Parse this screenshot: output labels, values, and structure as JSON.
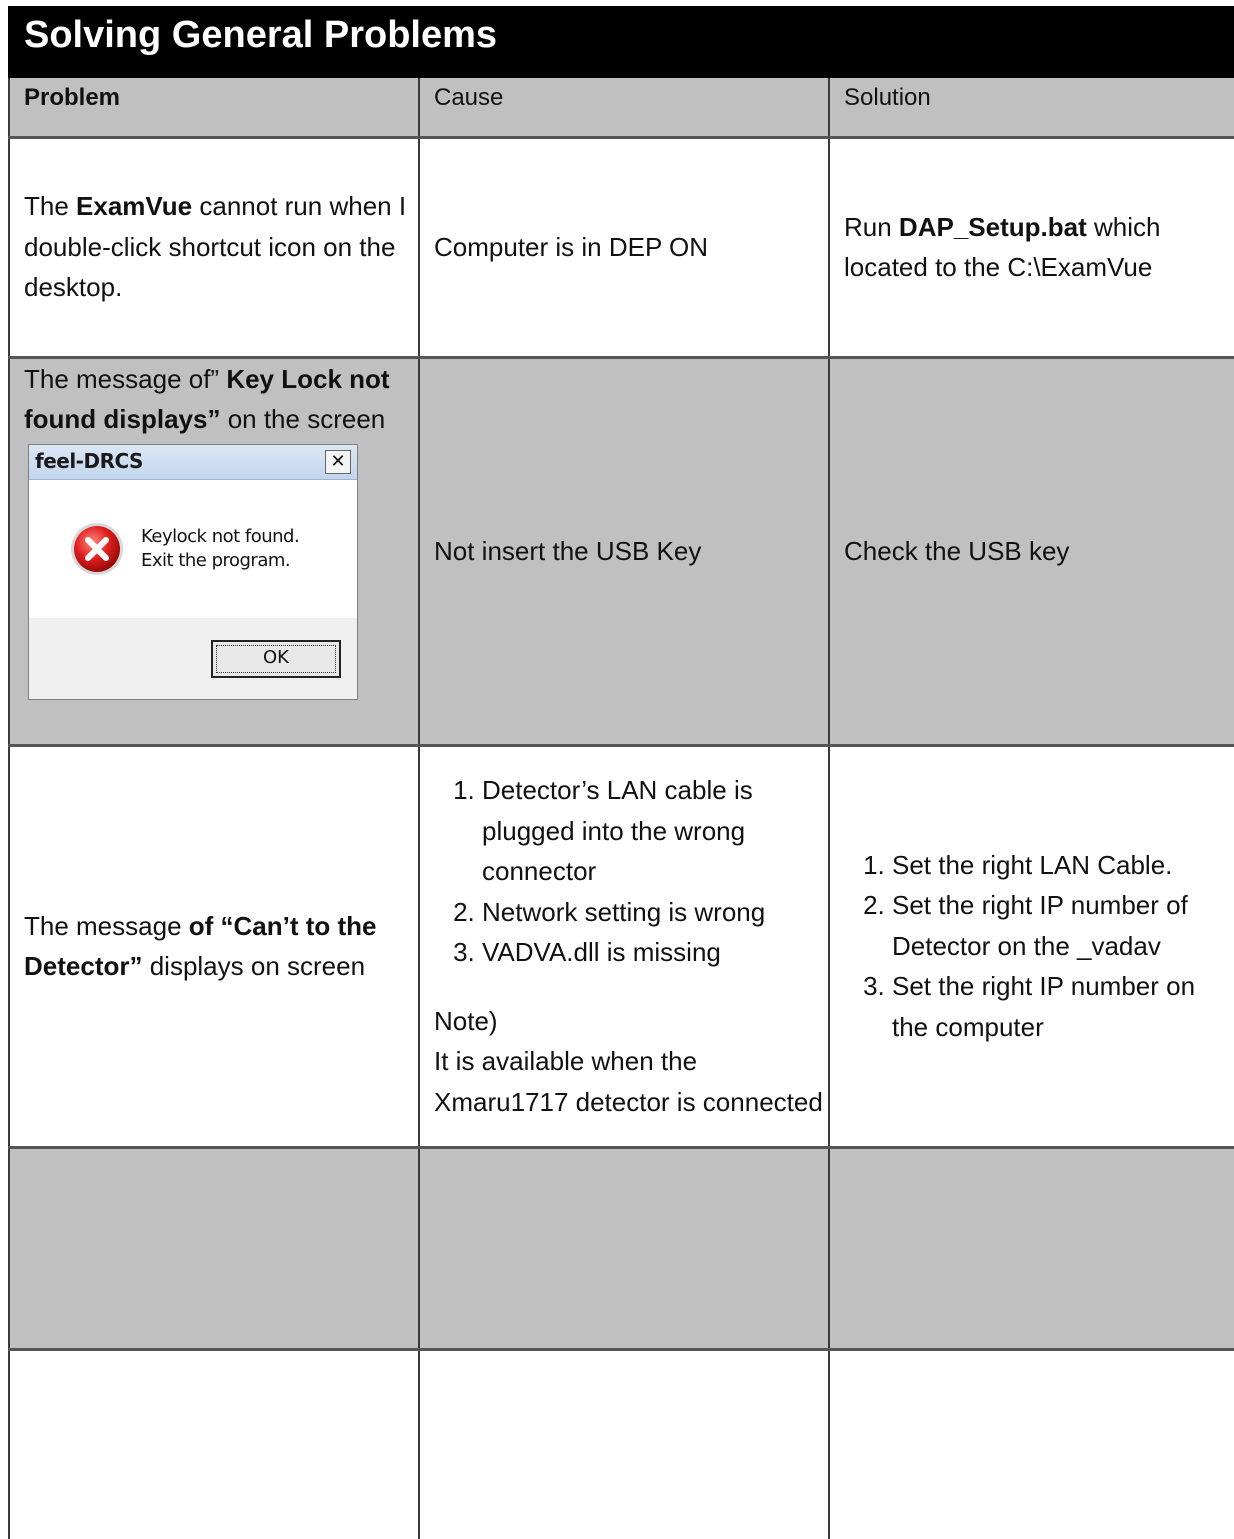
{
  "title": "Solving General Problems",
  "headers": {
    "problem": "Problem",
    "cause": "Cause",
    "solution": "Solution"
  },
  "row1": {
    "problem_pre": "The ",
    "problem_bold": "ExamVue",
    "problem_post": " cannot run when I double-click shortcut icon on the desktop.",
    "cause": "Computer is in DEP ON",
    "solution_pre": "Run ",
    "solution_bold": "DAP_Setup.bat",
    "solution_post": " which located to the C:\\ExamVue"
  },
  "row2": {
    "problem_pre": "The message of” ",
    "problem_bold": "Key Lock not found displays”",
    "problem_post": " on the screen",
    "dialog": {
      "title": "feel-DRCS",
      "close": "✕",
      "message_line1": "Keylock not found.",
      "message_line2": "Exit the program.",
      "ok": "OK",
      "icon": "error-icon"
    },
    "cause": "Not insert the USB Key",
    "solution": "Check the USB key"
  },
  "row3": {
    "problem_pre": "The message ",
    "problem_bold": "of “Can’t to the Detector”",
    "problem_post": " displays on screen",
    "causes": [
      "Detector’s LAN cable is plugged into the wrong connector",
      "Network setting is wrong",
      "VADVA.dll is missing"
    ],
    "note_label": "Note)",
    "note_text": "It is available when the Xmaru1717 detector is connected",
    "solutions": [
      "Set the right LAN Cable.",
      "Set the right IP number of Detector on the _vadav",
      "Set the right IP number on the computer"
    ]
  }
}
